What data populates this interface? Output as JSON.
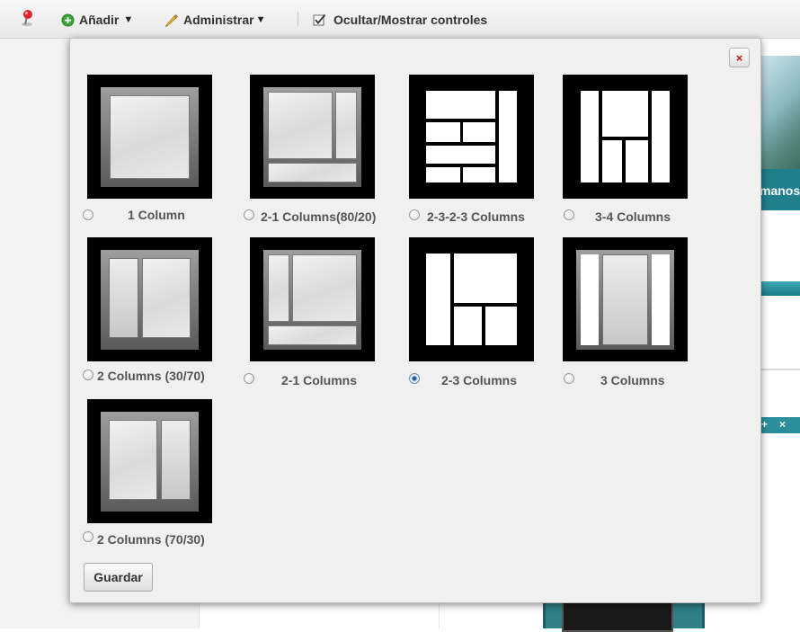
{
  "toolbar": {
    "add_label": "Añadir",
    "manage_label": "Administrar",
    "toggle_label": "Ocultar/Mostrar controles"
  },
  "background": {
    "teal_text": "manos",
    "plus": "+",
    "x": "×"
  },
  "modal": {
    "close_glyph": "×",
    "options": [
      {
        "label": "1 Column",
        "checked": false
      },
      {
        "label": "2-1 Columns(80/20)",
        "checked": false
      },
      {
        "label": "2-3-2-3 Columns",
        "checked": false
      },
      {
        "label": "3-4 Columns",
        "checked": false
      },
      {
        "label": "2 Columns (30/70)",
        "checked": false
      },
      {
        "label": "2-1 Columns",
        "checked": false
      },
      {
        "label": "2-3 Columns",
        "checked": true
      },
      {
        "label": "3 Columns",
        "checked": false
      },
      {
        "label": "2 Columns (70/30)",
        "checked": false
      }
    ],
    "save_label": "Guardar"
  },
  "colors": {
    "accent_teal": "#1f7f8d",
    "close_red": "#c4141b",
    "add_green": "#3aa73a"
  }
}
